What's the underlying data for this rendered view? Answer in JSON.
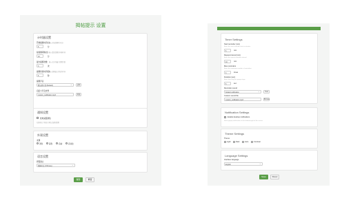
{
  "left": {
    "title": "揭帖提示 设置",
    "sections": {
      "time": {
        "title": "计时器设置",
        "fields": [
          {
            "label": "开始提醒时间(分)",
            "hint": "输入开始提醒时间(分)",
            "value": "5",
            "unit": "分"
          },
          {
            "label": "复提醒间隔(分)",
            "hint": "输入重复提醒的间隔时间",
            "value": "10",
            "unit": "分"
          },
          {
            "label": "最大提醒次数",
            "hint": "输入允许的最大提醒次数",
            "value": "3",
            "unit": "次"
          },
          {
            "label": "提醒持续时间(秒)",
            "hint": "输入提醒窗口持续的时间",
            "value": "5",
            "unit": "秒"
          }
        ],
        "sound_label": "提醒声音",
        "sound_value": "默认提示音 (Default)",
        "sound_button": "试听",
        "file_label": "自定义声音文件",
        "file_value": "custom_notification.mp3",
        "file_button": "浏览"
      },
      "notify": {
        "title": "通知设置",
        "checkbox_label": "启用桌面通知",
        "checkbox_hint": "在屏幕右下角显示弹出式通知提醒"
      },
      "theme": {
        "title": "外观设置",
        "label": "主题",
        "options": [
          "浅色",
          "深色",
          "自动",
          "高对比"
        ]
      },
      "lang": {
        "title": "语言设置",
        "label": "界面语言",
        "value": "简体中文 (Chinese)"
      }
    },
    "save": "保存",
    "reset": "重置"
  },
  "right": {
    "sections": {
      "timer": {
        "title": "Timer Settings",
        "fields": [
          {
            "label": "Start reminder (min)",
            "hint": "Enter the start reminder time in minutes",
            "value": "5",
            "unit": "min"
          },
          {
            "label": "Repeat interval (min)",
            "hint": "Enter the repeat reminder interval",
            "value": "10",
            "unit": "min"
          },
          {
            "label": "Max reminders",
            "hint": "Enter the maximum number of reminders",
            "value": "3",
            "unit": "times"
          },
          {
            "label": "Duration (sec)",
            "hint": "Enter how long the popup stays",
            "value": "5",
            "unit": "sec"
          }
        ],
        "sound_label": "Reminder sound",
        "sound_value": "Default notification",
        "sound_button": "Test",
        "file_label": "Custom sound file",
        "file_value": "custom_notification.mp3",
        "file_button": "Browse"
      },
      "notify": {
        "title": "Notification Settings",
        "checkbox_label": "Enable desktop notifications",
        "checkbox_hint": "Show popup notifications at the bottom-right of the screen"
      },
      "theme": {
        "title": "Theme Settings",
        "label": "Theme",
        "options": [
          "Light",
          "Dark",
          "Auto",
          "Contrast"
        ]
      },
      "lang": {
        "title": "Language Settings",
        "label": "Interface language",
        "value": "English"
      }
    },
    "save": "Save",
    "reset": "Reset"
  },
  "colors": {
    "accent": "#5a9e48",
    "panel": "#f4f5f4",
    "card": "#ffffff"
  }
}
